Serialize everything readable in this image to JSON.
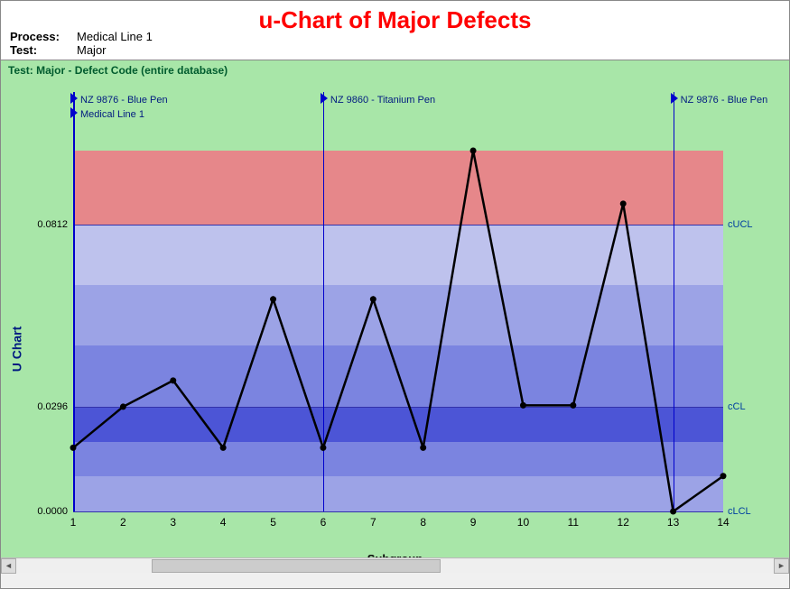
{
  "header": {
    "title": "u-Chart of Major Defects",
    "process_label": "Process:",
    "process_value": "Medical Line 1",
    "test_label": "Test:",
    "test_value": "Major"
  },
  "chart": {
    "subtitle": "Test: Major - Defect Code (entire database)",
    "ylabel": "U Chart",
    "xlabel": "Subgroup"
  },
  "limits": {
    "ucl": {
      "label": "cUCL",
      "value": 0.0812
    },
    "cl": {
      "label": "cCL",
      "value": 0.0296
    },
    "lcl": {
      "label": "cLCL",
      "value": 0.0
    }
  },
  "yticks": [
    "0.0812",
    "0.0296",
    "0.0000"
  ],
  "xticks": [
    "1",
    "2",
    "3",
    "4",
    "5",
    "6",
    "7",
    "8",
    "9",
    "10",
    "11",
    "12",
    "13",
    "14"
  ],
  "events": [
    {
      "x": 1,
      "top_label": "NZ 9876 - Blue Pen",
      "bottom_label": "Medical Line 1"
    },
    {
      "x": 6,
      "top_label": "NZ 9860 - Titanium Pen",
      "bottom_label": ""
    },
    {
      "x": 13,
      "top_label": "NZ 9876 - Blue Pen",
      "bottom_label": ""
    }
  ],
  "chart_data": {
    "type": "line",
    "title": "u-Chart of Major Defects",
    "xlabel": "Subgroup",
    "ylabel": "U Chart",
    "x": [
      1,
      2,
      3,
      4,
      5,
      6,
      7,
      8,
      9,
      10,
      11,
      12,
      13,
      14
    ],
    "values": [
      0.018,
      0.0296,
      0.037,
      0.018,
      0.06,
      0.018,
      0.06,
      0.018,
      0.102,
      0.03,
      0.03,
      0.087,
      0.0,
      0.01
    ],
    "control_limits": {
      "cUCL": 0.0812,
      "cCL": 0.0296,
      "cLCL": 0.0
    },
    "ymax_visible": 0.102,
    "ylim": [
      0.0,
      0.102
    ],
    "annotations": [
      {
        "x": 1,
        "text": "NZ 9876 - Blue Pen / Medical Line 1"
      },
      {
        "x": 6,
        "text": "NZ 9860 - Titanium Pen"
      },
      {
        "x": 13,
        "text": "NZ 9876 - Blue Pen"
      }
    ]
  }
}
